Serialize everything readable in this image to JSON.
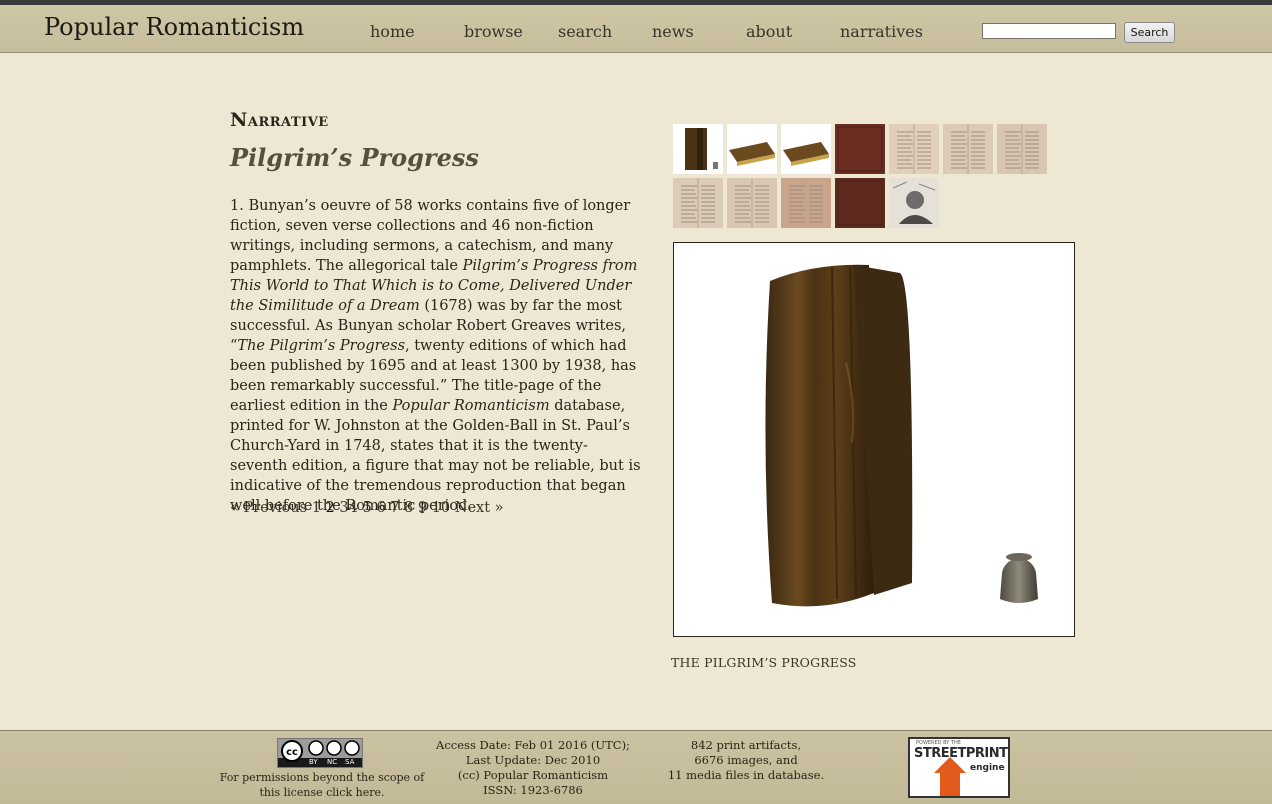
{
  "header": {
    "site_title": "Popular Romanticism",
    "nav": [
      "home",
      "browse",
      "search",
      "news",
      "about",
      "narratives"
    ],
    "search": {
      "input_value": "",
      "button_label": "Search"
    }
  },
  "main": {
    "kicker": "Narrative",
    "title": "Pilgrim’s Progress",
    "paragraph": [
      {
        "t": "1. Bunyan’s oeuvre of 58 works contains five of longer fiction, seven verse collections and 46 non-fiction writings, including sermons, a catechism, and many pamphlets. The allegorical tale "
      },
      {
        "t": "Pilgrim’s Progress from This World to That Which is to Come, Delivered Under the Similitude of a Dream",
        "i": true
      },
      {
        "t": " (1678) was by far the most successful. As Bunyan scholar Robert Greaves writes, “"
      },
      {
        "t": "The Pilgrim’s Progress",
        "i": true
      },
      {
        "t": ", twenty editions of which had been published by 1695 and at least 1300 by 1938, has been remarkably successful.” The title-page of the earliest edition in the "
      },
      {
        "t": "Popular Romanticism",
        "i": true
      },
      {
        "t": " database, printed for W. Johnston at the Golden-Ball in St. Paul’s Church-Yard in 1748, states that it is the twenty-seventh edition, a figure that may not be reliable, but is indicative of the tremendous reproduction that began well before the Romantic period."
      }
    ],
    "pager": {
      "previous": "« Previous",
      "pages": [
        "1",
        "2",
        "3",
        "4",
        "5",
        "6",
        "7",
        "8",
        "9",
        "10"
      ],
      "current": "2",
      "next": "Next »"
    },
    "thumbnails": [
      {
        "name": "book-standing-thumbnail",
        "kind": "book-standing",
        "bg": "#ffffff"
      },
      {
        "name": "book-closed-thumbnail",
        "kind": "book-flat",
        "bg": "#ffffff"
      },
      {
        "name": "book-edge-thumbnail",
        "kind": "book-flat",
        "bg": "#ffffff"
      },
      {
        "name": "cover-thumbnail",
        "kind": "cover",
        "bg": "#6b2d22"
      },
      {
        "name": "title-page-thumbnail",
        "kind": "page",
        "bg": "#e2cfbb"
      },
      {
        "name": "text-page-thumbnail",
        "kind": "page",
        "bg": "#ddcab6"
      },
      {
        "name": "text-page-2-thumbnail",
        "kind": "page",
        "bg": "#d9c6b2"
      },
      {
        "name": "illustrated-page-thumbnail",
        "kind": "page",
        "bg": "#dccbb8"
      },
      {
        "name": "spread-thumbnail",
        "kind": "page",
        "bg": "#d9c7b4"
      },
      {
        "name": "end-page-thumbnail",
        "kind": "page",
        "bg": "#c9a58b"
      },
      {
        "name": "back-cover-thumbnail",
        "kind": "cover",
        "bg": "#5e2a20"
      },
      {
        "name": "engraving-thumbnail",
        "kind": "engraving",
        "bg": "#e5e0d8"
      }
    ],
    "image_caption": "THE PILGRIM’S PROGRESS"
  },
  "footer": {
    "cc_badge_labels": [
      "BY",
      "NC",
      "SA"
    ],
    "permissions_text": "For permissions beyond the scope of this license click",
    "permissions_link": "here",
    "permissions_end": ".",
    "access_date": "Access Date: Feb 01 2016 (UTC);",
    "last_update": "Last Update: Dec 2010",
    "copyright": "(cc) Popular Romanticism",
    "issn": "ISSN: 1923-6786",
    "stats_artifacts": "842 print artifacts,",
    "stats_images": "6676 images, and",
    "stats_media": "11 media files in database.",
    "powered_label": "POWERED BY THE",
    "streetprint_word": "STREETPRINT",
    "engine_word": "engine"
  }
}
